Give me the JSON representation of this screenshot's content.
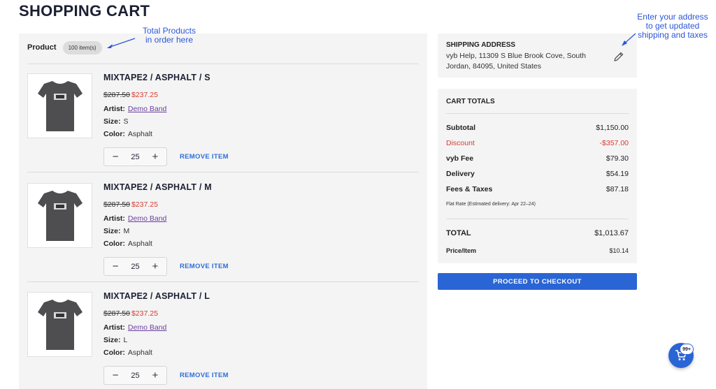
{
  "page": {
    "title": "SHOPPING CART"
  },
  "cart": {
    "header_label": "Product",
    "item_count": "100 item(s)",
    "remove_label": "REMOVE ITEM",
    "artist_key": "Artist:",
    "size_key": "Size:",
    "color_key": "Color:",
    "items": [
      {
        "name": "MIXTAPE2 / ASPHALT / S",
        "old_price": "$287.50",
        "new_price": "$237.25",
        "artist": "Demo Band",
        "size": "S",
        "color": "Asphalt",
        "qty": "25"
      },
      {
        "name": "MIXTAPE2 / ASPHALT / M",
        "old_price": "$287.50",
        "new_price": "$237.25",
        "artist": "Demo Band",
        "size": "M",
        "color": "Asphalt",
        "qty": "25"
      },
      {
        "name": "MIXTAPE2 / ASPHALT / L",
        "old_price": "$287.50",
        "new_price": "$237.25",
        "artist": "Demo Band",
        "size": "L",
        "color": "Asphalt",
        "qty": "25"
      }
    ]
  },
  "shipping": {
    "title": "SHIPPING ADDRESS",
    "address": "vyb Help, 11309 S Blue Brook Cove, South Jordan, 84095, United States"
  },
  "totals": {
    "title": "CART TOTALS",
    "subtotal_label": "Subtotal",
    "subtotal": "$1,150.00",
    "discount_label": "Discount",
    "discount": "-$357.00",
    "fee_label": "vyb Fee",
    "fee": "$79.30",
    "delivery_label": "Delivery",
    "delivery": "$54.19",
    "taxes_label": "Fees & Taxes",
    "taxes": "$87.18",
    "flat_rate": "Flat Rate (Estimated delivery: Apr 22–24)",
    "total_label": "TOTAL",
    "total": "$1,013.67",
    "per_item_label": "Price/Item",
    "per_item": "$10.14"
  },
  "checkout": {
    "label": "PROCEED TO CHECKOUT"
  },
  "annotations": {
    "products_line1": "Total Products",
    "products_line2": "in order here",
    "address_line1": "Enter your address",
    "address_line2": "to get updated",
    "address_line3": "shipping and taxes"
  },
  "fab": {
    "badge": "99+"
  },
  "colors": {
    "accent": "#2a65d6",
    "discount": "#d63b30",
    "link": "#6a3fa0",
    "annotation": "#2b55d8",
    "panel": "#f4f4f4"
  },
  "icons": {
    "edit": "pencil-icon",
    "cart": "cart-icon",
    "minus": "minus-icon",
    "plus": "plus-icon"
  }
}
